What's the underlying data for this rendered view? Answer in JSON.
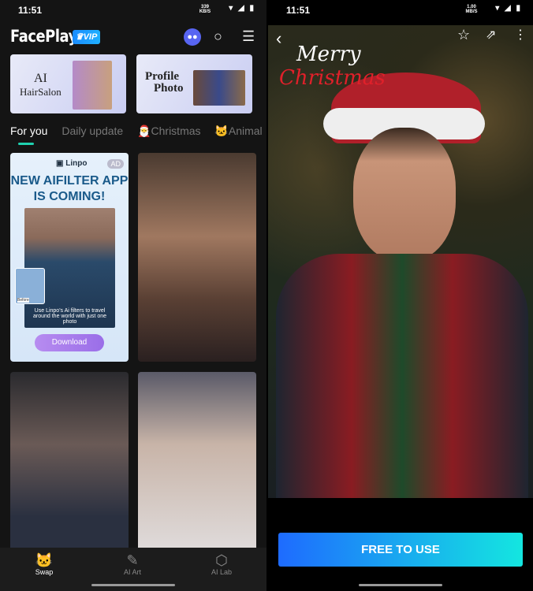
{
  "left": {
    "status": {
      "time": "11:51",
      "speed": "339 KB/S"
    },
    "header": {
      "logo": "FacePlay",
      "vip": "VIP"
    },
    "banners": [
      {
        "line1": "AI",
        "line2": "HairSalon"
      },
      {
        "line1": "Profile",
        "line2": "Photo"
      }
    ],
    "tabs": [
      "For you",
      "Daily update",
      "🎅Christmas",
      "🐱Animal"
    ],
    "ad": {
      "brand": "Linpo",
      "badge": "AD",
      "headline1": "NEW AIFILTER APP",
      "headline2": "IS COMING!",
      "before": "Before",
      "caption": "Use Linpo's Ai filters to travel around the world with just one photo",
      "button": "Download"
    },
    "nav": [
      {
        "label": "Swap",
        "icon": "mask-icon"
      },
      {
        "label": "AI Art",
        "icon": "palette-brush-icon"
      },
      {
        "label": "AI Lab",
        "icon": "cube-icon"
      }
    ]
  },
  "right": {
    "status": {
      "time": "11:51",
      "speed": "1.00 MB/S"
    },
    "overlay": {
      "merry": "Merry",
      "christmas": "Christmas"
    },
    "cta": "FREE TO USE"
  }
}
